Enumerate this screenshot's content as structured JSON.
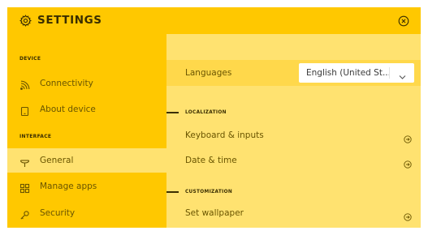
{
  "header": {
    "title": "SETTINGS",
    "icon": "gear-icon",
    "close_icon": "close-circle-icon"
  },
  "sidebar": {
    "sections": [
      {
        "label": "DEVICE"
      },
      {
        "label": "INTERFACE"
      }
    ],
    "items": [
      {
        "label": "Connectivity",
        "icon": "wifi-icon"
      },
      {
        "label": "About device",
        "icon": "device-icon"
      },
      {
        "label": "General",
        "icon": "antenna-icon",
        "active": true
      },
      {
        "label": "Manage apps",
        "icon": "apps-grid-icon"
      },
      {
        "label": "Security",
        "icon": "key-icon"
      }
    ]
  },
  "main": {
    "languages": {
      "label": "Languages",
      "selected": "English (United St...",
      "icon": "chevron-down-icon"
    },
    "localization": {
      "heading": "LOCALIZATION",
      "rows": [
        {
          "label": "Keyboard & inputs",
          "icon": "arrow-right-circle-icon"
        },
        {
          "label": "Date & time",
          "icon": "arrow-right-circle-icon"
        }
      ]
    },
    "customization": {
      "heading": "CUSTOMIZATION",
      "rows": [
        {
          "label": "Set wallpaper",
          "icon": "arrow-right-circle-icon"
        }
      ]
    }
  },
  "colors": {
    "accent": "#ffc800",
    "panel": "#ffe270",
    "highlight": "#ffd84b",
    "text_dark": "#3a2e00",
    "text_muted": "#6a5500"
  }
}
